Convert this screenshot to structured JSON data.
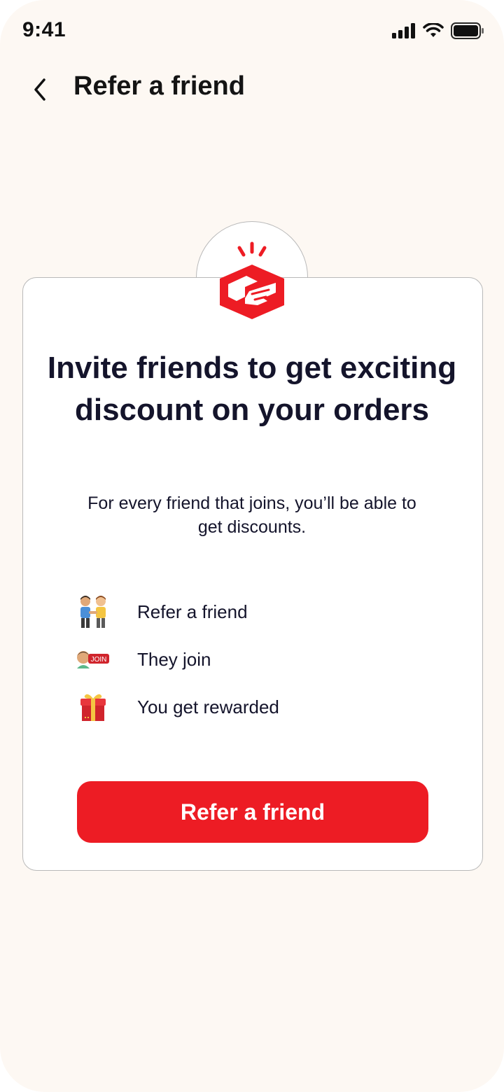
{
  "status_bar": {
    "time": "9:41"
  },
  "header": {
    "title": "Refer a friend",
    "back_icon": "chevron-left-icon"
  },
  "card": {
    "headline": "Invite friends to get exciting discount on your orders",
    "subtext": "For every friend that joins, you’ll be able to get discounts.",
    "steps": [
      {
        "label": "Refer a friend",
        "icon": "friends-holding-hands-icon"
      },
      {
        "label": "They join",
        "icon": "person-join-badge-icon",
        "badge_text": "JOIN"
      },
      {
        "label": "You get rewarded",
        "icon": "gift-box-icon"
      }
    ],
    "cta_label": "Refer a friend"
  },
  "colors": {
    "accent": "#ed1c24",
    "background": "#fdf8f3",
    "text_dark": "#14142b"
  }
}
